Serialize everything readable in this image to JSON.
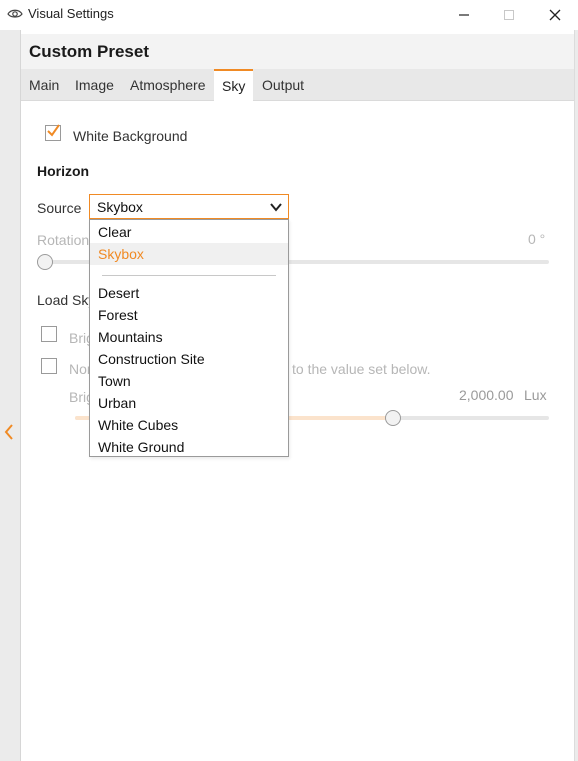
{
  "window": {
    "title": "Visual Settings",
    "icon": "eye-icon",
    "minimize_icon": "minimize-icon",
    "maximize_icon": "maximize-icon",
    "close_icon": "close-icon"
  },
  "panel": {
    "title": "Custom Preset",
    "tabs": [
      "Main",
      "Image",
      "Atmosphere",
      "Sky",
      "Output"
    ],
    "active_tab": "Sky"
  },
  "colors": {
    "accent": "#f08a24",
    "panel_bg": "#f3f3f3",
    "tab_bar": "#e8e8e8",
    "gutter": "#ebebeb"
  },
  "sky": {
    "white_background_label": "White Background",
    "white_background_checked": true,
    "horizon_heading": "Horizon",
    "source_label": "Source",
    "source_value": "Skybox",
    "rotation_label": "Rotation",
    "rotation_value": "0 °",
    "rotation_fraction": 0.0,
    "load_sky_label": "Load Sky",
    "brightness_check_label": "Brig",
    "normalize_label": "Nor",
    "normalize_suffix": "to the value set below.",
    "brightness_label": "Brig",
    "brightness_value": "2,000.00",
    "brightness_unit": "Lux",
    "brightness_fraction": 0.67
  },
  "dropdown": {
    "options_top": [
      "Clear",
      "Skybox"
    ],
    "selected": "Skybox",
    "options_bottom": [
      "Desert",
      "Forest",
      "Mountains",
      "Construction Site",
      "Town",
      "Urban",
      "White Cubes",
      "White Ground"
    ]
  },
  "gutter": {
    "expand_icon": "chevron-left-icon"
  }
}
